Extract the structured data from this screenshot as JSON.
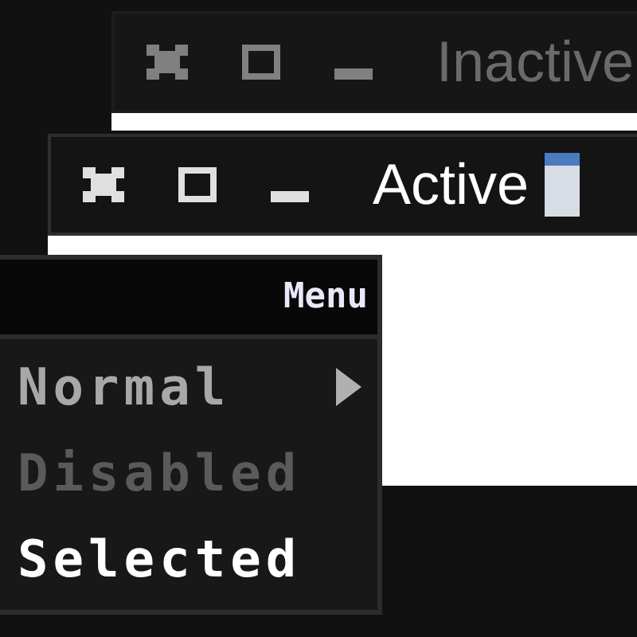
{
  "windows": [
    {
      "title": "Inactive",
      "active": false,
      "buttons": [
        {
          "kind": "close"
        },
        {
          "kind": "maximize"
        },
        {
          "kind": "minimize"
        }
      ]
    },
    {
      "title": "Active",
      "active": true,
      "app_icon": true,
      "buttons": [
        {
          "kind": "close"
        },
        {
          "kind": "maximize"
        },
        {
          "kind": "minimize"
        }
      ]
    }
  ],
  "menu": {
    "title": "Menu",
    "items": [
      {
        "label": "Normal",
        "submenu": true,
        "disabled": false,
        "selected": false
      },
      {
        "label": "Disabled",
        "submenu": false,
        "disabled": true,
        "selected": false
      },
      {
        "label": "Selected",
        "submenu": false,
        "disabled": false,
        "selected": true
      }
    ]
  }
}
